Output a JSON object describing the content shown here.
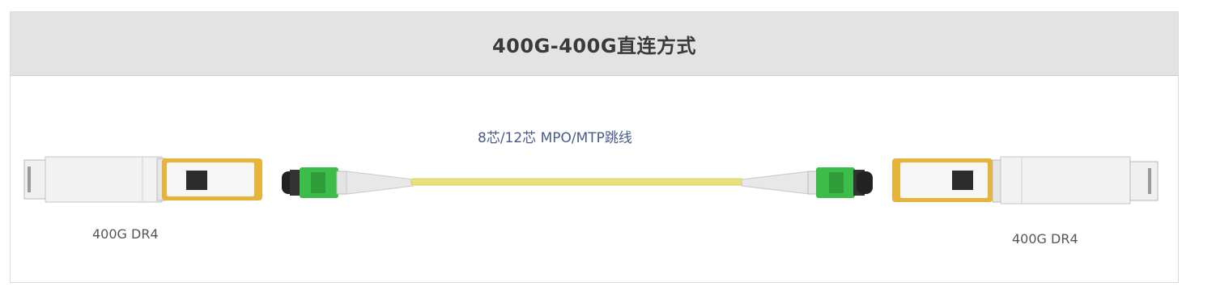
{
  "title": "400G-400G直连方式",
  "cable": {
    "label": "8芯/12芯  MPO/MTP跳线"
  },
  "modules": {
    "left_label": "400G DR4",
    "right_label": "400G DR4"
  },
  "colors": {
    "header_bg": "#e3e3e3",
    "module_latch": "#e5b43a",
    "connector_green": "#3cbc48",
    "fiber_yellow": "#e9e27a"
  }
}
